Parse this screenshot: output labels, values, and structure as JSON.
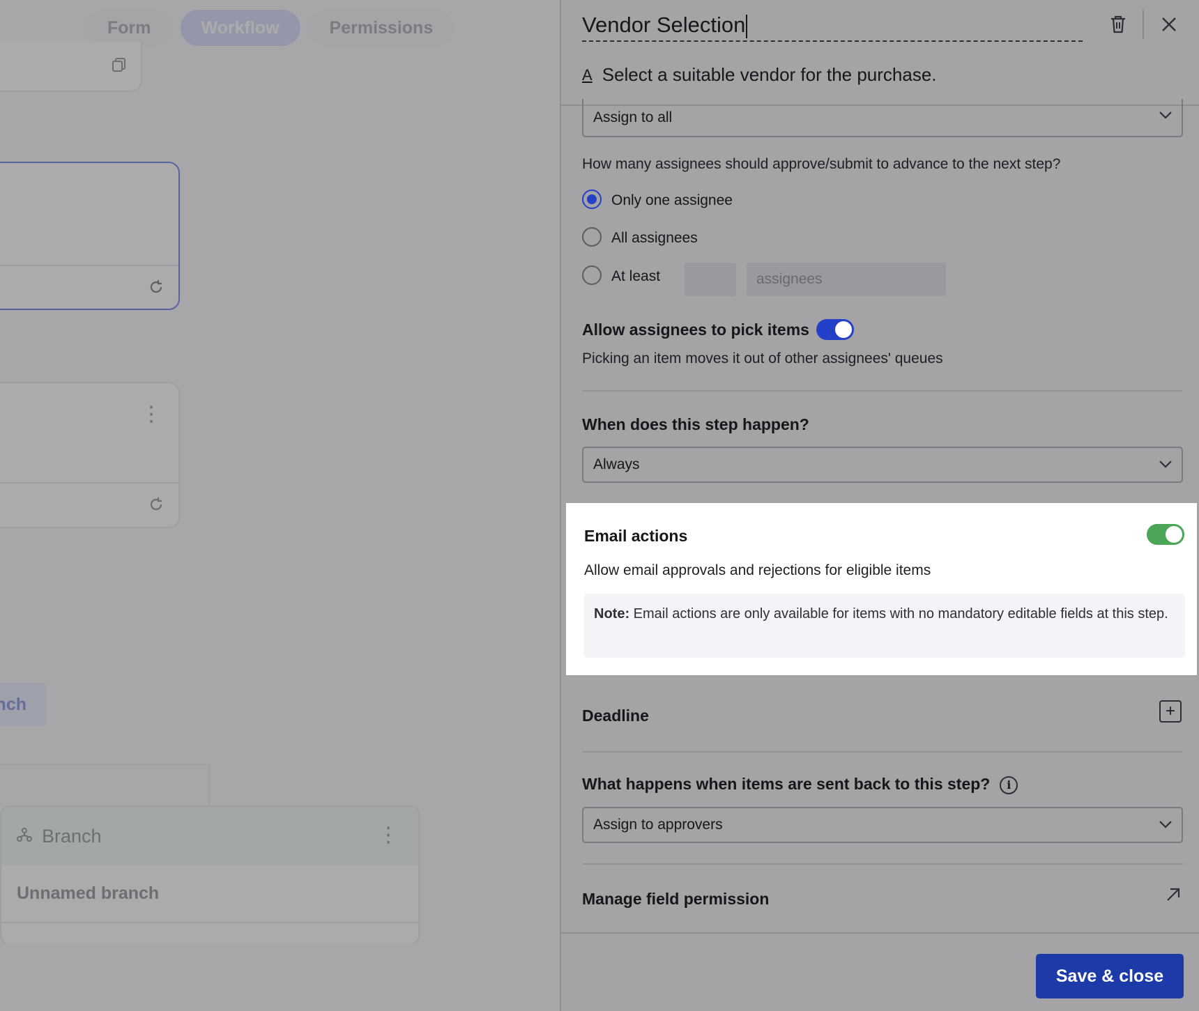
{
  "canvas": {
    "tabs": [
      {
        "label": "Form"
      },
      {
        "label": "Workflow"
      },
      {
        "label": "Permissions"
      }
    ],
    "add_branch_label": "nch",
    "branch": {
      "header_label": "Branch",
      "name": "Unnamed branch"
    }
  },
  "panel": {
    "title": "Vendor Selection",
    "description": "Select a suitable vendor for the purchase.",
    "assignment_select": {
      "value": "Assign to all"
    },
    "approval_question": "How many assignees should approve/submit to advance to the next step?",
    "approval_options": [
      {
        "label": "Only one assignee",
        "checked": true
      },
      {
        "label": "All assignees",
        "checked": false
      },
      {
        "label": "At least",
        "checked": false
      }
    ],
    "at_least": {
      "count_value": "",
      "assignees_placeholder": "assignees"
    },
    "pick_items": {
      "label": "Allow assignees to pick items",
      "enabled": true,
      "hint": "Picking an item moves it out of other assignees' queues"
    },
    "when_happens": {
      "heading": "When does this step happen?",
      "value": "Always"
    },
    "email_actions": {
      "heading": "Email actions",
      "enabled": true,
      "description": "Allow email approvals and rejections for eligible items",
      "note_label": "Note:",
      "note_text": "Email actions are only available for items with no mandatory editable fields at this step."
    },
    "deadline": {
      "heading": "Deadline"
    },
    "sent_back": {
      "heading": "What happens when items are sent back to this step?",
      "value": "Assign to approvers"
    },
    "manage_permission": {
      "label": "Manage field permission"
    },
    "save_button": "Save & close"
  },
  "colors": {
    "accent_blue": "#2340c8",
    "save_button": "#1c3aa8",
    "toggle_green": "#4aa656"
  },
  "icons": [
    "trash-icon",
    "close-icon",
    "text-format-icon",
    "chevron-down-icon",
    "plus-icon",
    "info-icon",
    "external-arrow-icon",
    "kebab-menu-icon",
    "branch-icon",
    "copy-icon",
    "refresh-icon"
  ]
}
